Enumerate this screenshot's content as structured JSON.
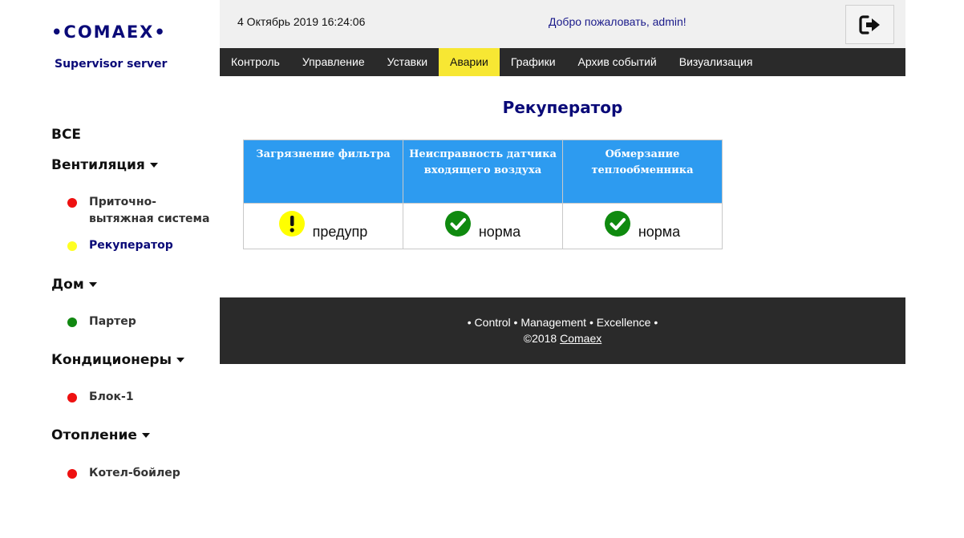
{
  "brand": {
    "logo": "•COMAEX•",
    "subtitle": "Supervisor server"
  },
  "header": {
    "datetime": "4 Октябрь 2019 16:24:06",
    "welcome": "Добро пожаловать, admin!",
    "logout_icon": "sign-out-icon"
  },
  "nav": {
    "items": [
      {
        "label": "Контроль"
      },
      {
        "label": "Управление"
      },
      {
        "label": "Уставки"
      },
      {
        "label": "Аварии",
        "active": true
      },
      {
        "label": "Графики"
      },
      {
        "label": "Архив событий"
      },
      {
        "label": "Визуализация"
      }
    ],
    "active_color": "#f7e733"
  },
  "sidebar": {
    "all_label": "ВСЕ",
    "groups": [
      {
        "label": "Вентиляция",
        "items": [
          {
            "label": "Приточно-вытяжная система",
            "status_color": "#ee1111"
          },
          {
            "label": "Рекуператор",
            "status_color": "#ffff22",
            "active": true
          }
        ]
      },
      {
        "label": "Дом",
        "items": [
          {
            "label": "Партер",
            "status_color": "#118811"
          }
        ]
      },
      {
        "label": "Кондиционеры",
        "items": [
          {
            "label": "Блок-1",
            "status_color": "#ee1111"
          }
        ]
      },
      {
        "label": "Отопление",
        "items": [
          {
            "label": "Котел-бойлер",
            "status_color": "#ee1111"
          }
        ]
      }
    ]
  },
  "main": {
    "title": "Рекуператор",
    "table": {
      "header_color": "#2d9bf0",
      "columns": [
        "Загрязнение фильтра",
        "Неисправность датчика входящего воздуха",
        "Обмерзание теплообменника"
      ],
      "statuses": [
        {
          "text": "предупр",
          "icon": "warning-icon",
          "color": "#ffff00"
        },
        {
          "text": "норма",
          "icon": "check-icon",
          "color": "#0f8a0f"
        },
        {
          "text": "норма",
          "icon": "check-icon",
          "color": "#0f8a0f"
        }
      ]
    }
  },
  "footer": {
    "tagline": "• Control • Management • Excellence •",
    "copyright_prefix": "©2018",
    "copyright_link": "Comaex"
  }
}
